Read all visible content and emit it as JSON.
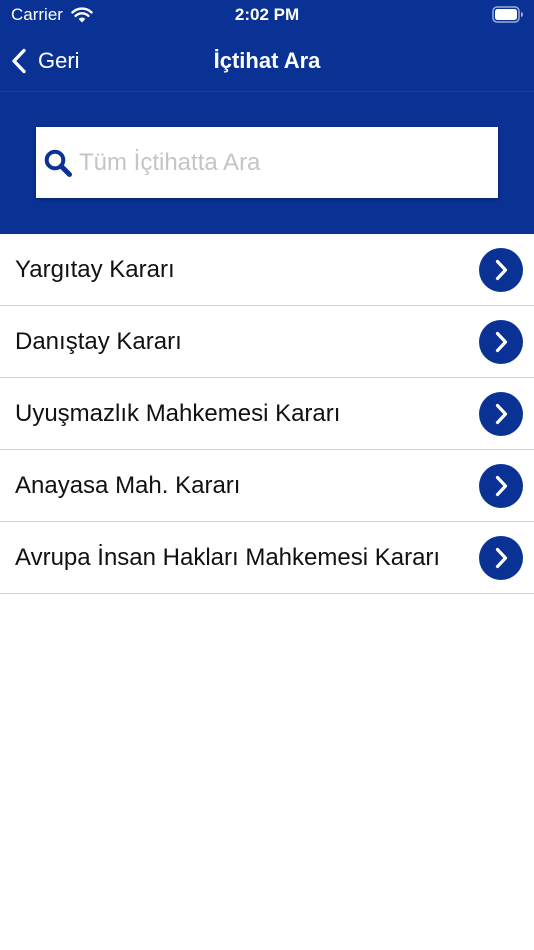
{
  "status_bar": {
    "carrier": "Carrier",
    "time": "2:02 PM"
  },
  "nav": {
    "back_label": "Geri",
    "title": "İçtihat Ara"
  },
  "search": {
    "placeholder": "Tüm İçtihatta Ara",
    "value": ""
  },
  "list": {
    "items": [
      {
        "label": "Yargıtay Kararı"
      },
      {
        "label": "Danıştay Kararı"
      },
      {
        "label": "Uyuşmazlık Mahkemesi Kararı"
      },
      {
        "label": "Anayasa Mah. Kararı"
      },
      {
        "label": "Avrupa İnsan Hakları Mahkemesi Kararı"
      }
    ]
  },
  "icons": {
    "back": "chevron-left-icon",
    "search": "search-icon",
    "row_arrow": "chevron-right-icon",
    "wifi": "wifi-icon",
    "battery": "battery-icon"
  },
  "colors": {
    "primary": "#0a3294",
    "placeholder": "#c4c4c9",
    "divider": "#d5d5d9",
    "text": "#111111"
  }
}
